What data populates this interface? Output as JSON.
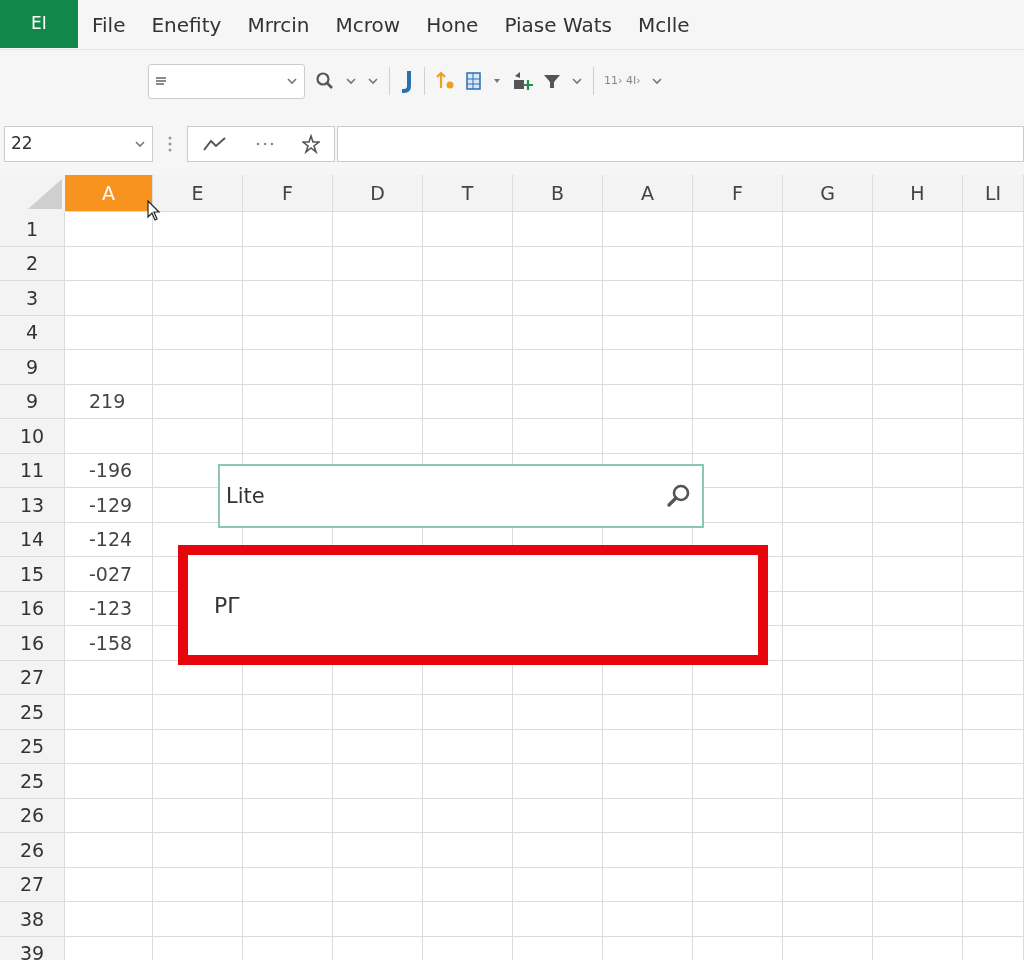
{
  "app": {
    "logo": "EI"
  },
  "menu": [
    {
      "label": "File"
    },
    {
      "label": "Enefity"
    },
    {
      "label": "Mrrcin"
    },
    {
      "label": "Mcrow"
    },
    {
      "label": "Hone"
    },
    {
      "label": "Piase Wats"
    },
    {
      "label": "Mclle"
    }
  ],
  "toolbar": {
    "zoom_text": "11› 4I›"
  },
  "name_box": {
    "value": "22"
  },
  "columns": [
    {
      "label": "A",
      "selected": true
    },
    {
      "label": "E",
      "selected": false
    },
    {
      "label": "F",
      "selected": false
    },
    {
      "label": "D",
      "selected": false
    },
    {
      "label": "T",
      "selected": false
    },
    {
      "label": "B",
      "selected": false
    },
    {
      "label": "A",
      "selected": false
    },
    {
      "label": "F",
      "selected": false
    },
    {
      "label": "G",
      "selected": false
    },
    {
      "label": "H",
      "selected": false
    },
    {
      "label": "LI",
      "selected": false
    }
  ],
  "rows": [
    {
      "label": "1"
    },
    {
      "label": "2"
    },
    {
      "label": "3"
    },
    {
      "label": "4"
    },
    {
      "label": "9"
    },
    {
      "label": "9",
      "value": "219"
    },
    {
      "label": "10"
    },
    {
      "label": "11",
      "value": "-196"
    },
    {
      "label": "13",
      "value": "-129"
    },
    {
      "label": "14",
      "value": "-124"
    },
    {
      "label": "15",
      "value": "-027"
    },
    {
      "label": "16",
      "value": "-123"
    },
    {
      "label": "16",
      "value": "-158"
    },
    {
      "label": "27"
    },
    {
      "label": "25"
    },
    {
      "label": "25"
    },
    {
      "label": "25"
    },
    {
      "label": "26"
    },
    {
      "label": "26"
    },
    {
      "label": "27"
    },
    {
      "label": "38"
    },
    {
      "label": "39"
    }
  ],
  "search": {
    "value": "Lite"
  },
  "highlight_box": {
    "text": "PГ"
  }
}
